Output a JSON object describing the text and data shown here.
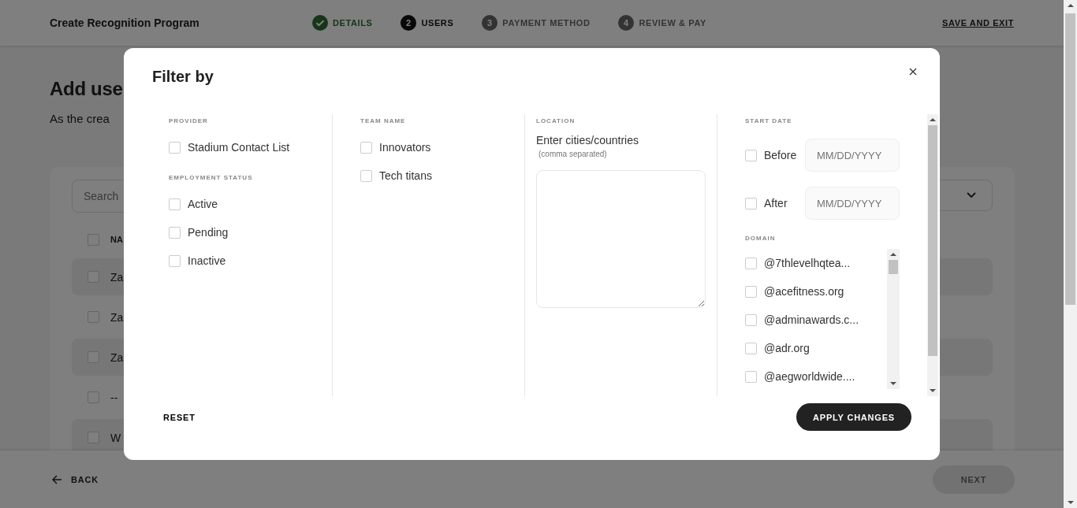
{
  "header": {
    "title": "Create Recognition Program",
    "steps": [
      {
        "label": "DETAILS",
        "completed": true,
        "selected": false
      },
      {
        "number": "2",
        "label": "USERS",
        "completed": false,
        "selected": true
      },
      {
        "number": "3",
        "label": "PAYMENT METHOD",
        "completed": false,
        "selected": false
      },
      {
        "number": "4",
        "label": "REVIEW & PAY",
        "completed": false,
        "selected": false
      }
    ],
    "save_exit": "SAVE AND EXIT"
  },
  "page": {
    "heading": "Add use",
    "intro": "As the crea",
    "search": {
      "placeholder": "Search"
    },
    "table": {
      "header": "NA",
      "header_checked": false,
      "rows": [
        {
          "name": "Za",
          "checked": false
        },
        {
          "name": "Za",
          "checked": false
        },
        {
          "name": "Za",
          "checked": false
        },
        {
          "name": "--",
          "checked": false
        },
        {
          "name": "W",
          "checked": false
        }
      ]
    }
  },
  "footer": {
    "back": "BACK",
    "next": {
      "label": "NEXT",
      "disabled": true
    }
  },
  "filter": {
    "title": "Filter by",
    "columns": [
      {
        "sections": [
          {
            "kind": "checkboxes",
            "heading": "PROVIDER",
            "options": [
              {
                "label": "Stadium Contact List",
                "checked": false
              }
            ]
          },
          {
            "kind": "checkboxes",
            "heading": "EMPLOYMENT STATUS",
            "options": [
              {
                "label": "Active",
                "checked": false
              },
              {
                "label": "Pending",
                "checked": false
              },
              {
                "label": "Inactive",
                "checked": false
              }
            ]
          }
        ]
      },
      {
        "sections": [
          {
            "kind": "checkboxes",
            "heading": "TEAM NAME",
            "options": [
              {
                "label": "Innovators",
                "checked": false
              },
              {
                "label": "Tech titans",
                "checked": false
              }
            ]
          }
        ]
      },
      {
        "sections": [
          {
            "kind": "textarea",
            "heading": "LOCATION",
            "label": "Enter cities/countries",
            "hint": "(comma separated)"
          }
        ]
      },
      {
        "sections": [
          {
            "kind": "dates",
            "heading": "START DATE",
            "options": [
              {
                "label": "Before",
                "checked": false,
                "placeholder": "MM/DD/YYYY"
              },
              {
                "label": "After",
                "checked": false,
                "placeholder": "MM/DD/YYYY"
              }
            ]
          },
          {
            "kind": "list",
            "heading": "DOMAIN",
            "options": [
              {
                "label": "@7thlevelhqtea...",
                "checked": false
              },
              {
                "label": "@acefitness.org",
                "checked": false
              },
              {
                "label": "@adminawards.c...",
                "checked": false
              },
              {
                "label": "@adr.org",
                "checked": false
              },
              {
                "label": "@aegworldwide....",
                "checked": false
              }
            ]
          }
        ]
      }
    ],
    "reset": "RESET",
    "apply": "APPLY CHANGES"
  }
}
